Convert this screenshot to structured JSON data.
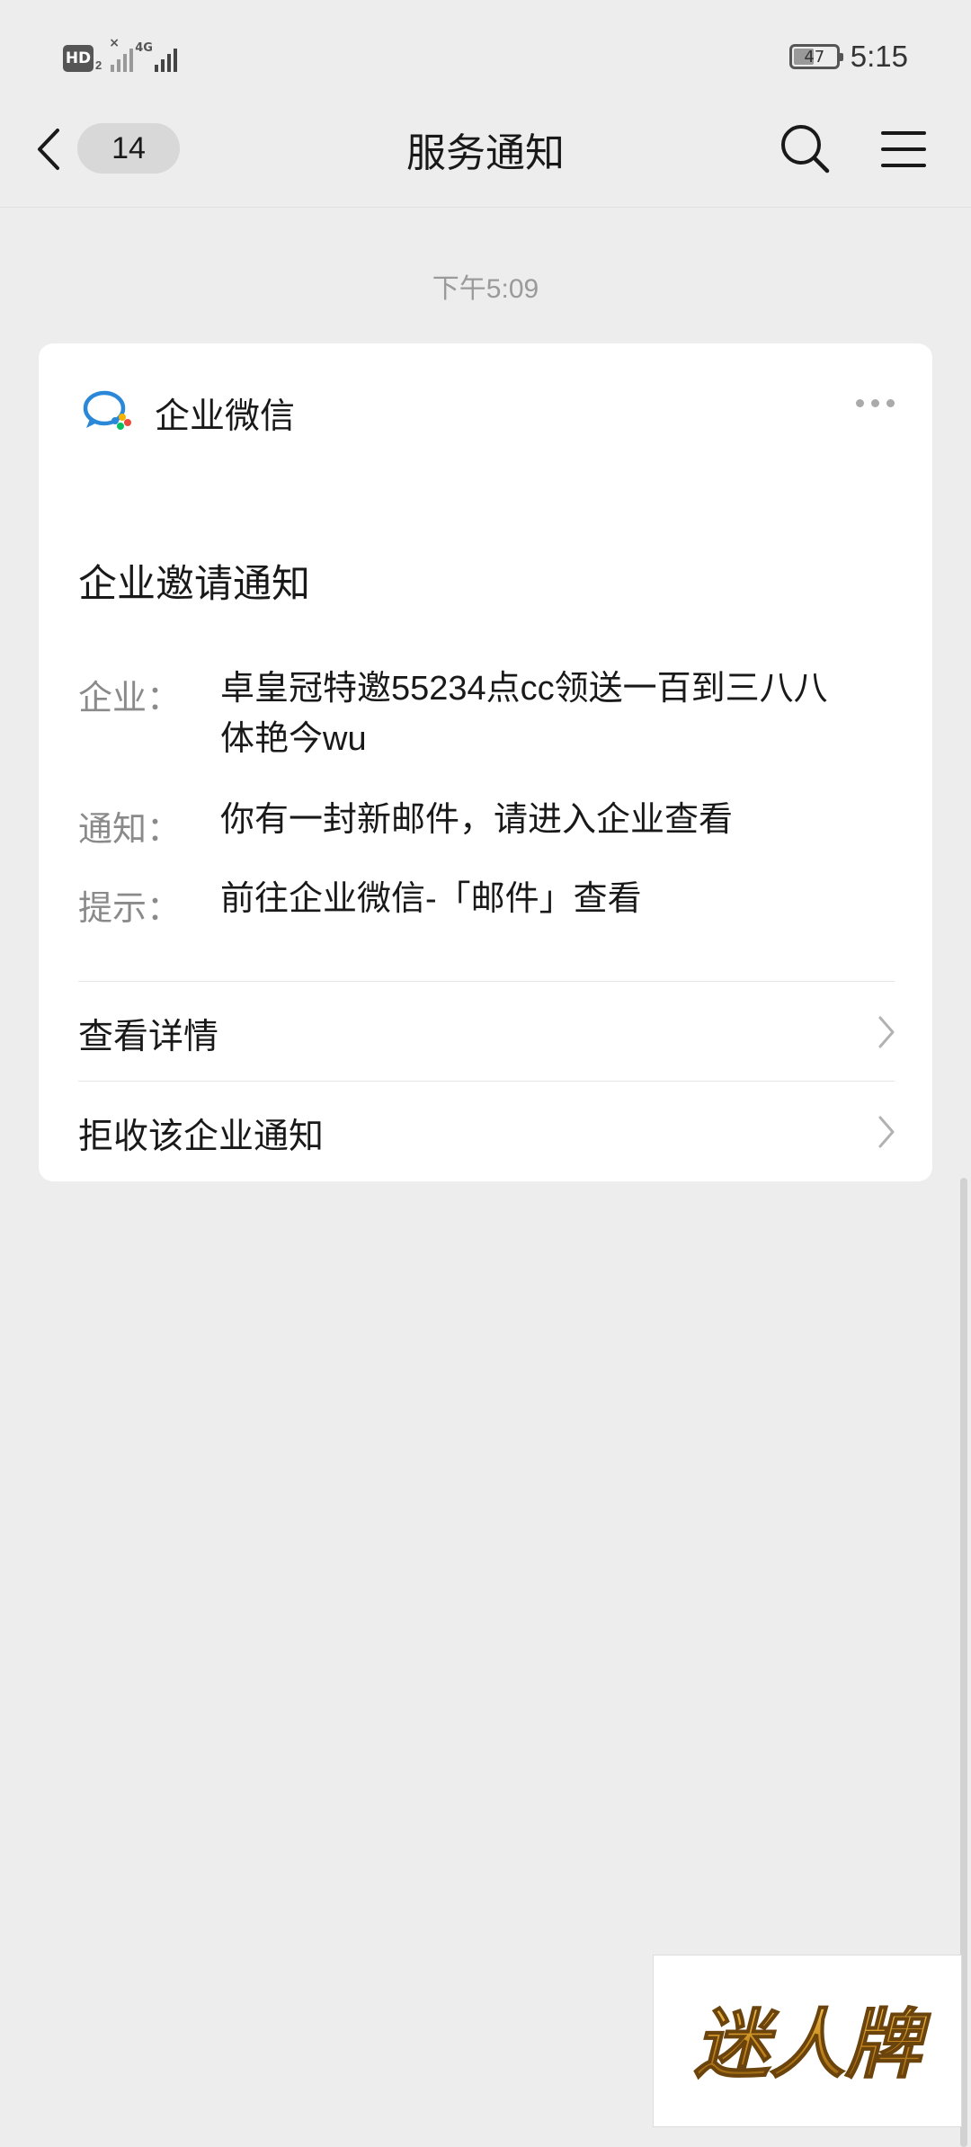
{
  "status_bar": {
    "hd_label": "HD",
    "sim_index": "2",
    "network_label": "4G",
    "battery_level": "47",
    "time": "5:15"
  },
  "nav": {
    "unread_count": "14",
    "title": "服务通知",
    "icons": [
      "chevron-left-icon",
      "search-icon",
      "menu-icon"
    ]
  },
  "timestamp": "下午5:09",
  "card": {
    "app_name": "企业微信",
    "title": "企业邀请通知",
    "fields": [
      {
        "label": "企业：",
        "value_lines": [
          "卓皇冠特邀55234点cc领送一百到三八八",
          "体艳今wu"
        ]
      },
      {
        "label": "通知：",
        "value_lines": [
          "你有一封新邮件，请进入企业查看"
        ]
      },
      {
        "label": "提示：",
        "value_lines": [
          "前往企业微信-「邮件」查看"
        ]
      }
    ],
    "actions": [
      {
        "label": "查看详情"
      },
      {
        "label": "拒收该企业通知"
      }
    ]
  },
  "watermark": {
    "text": "迷人牌",
    "color": "#c98a1e"
  },
  "colors": {
    "background": "#ededed",
    "card": "#ffffff",
    "primary_text": "#191919",
    "secondary_text": "#8a8a8a"
  }
}
